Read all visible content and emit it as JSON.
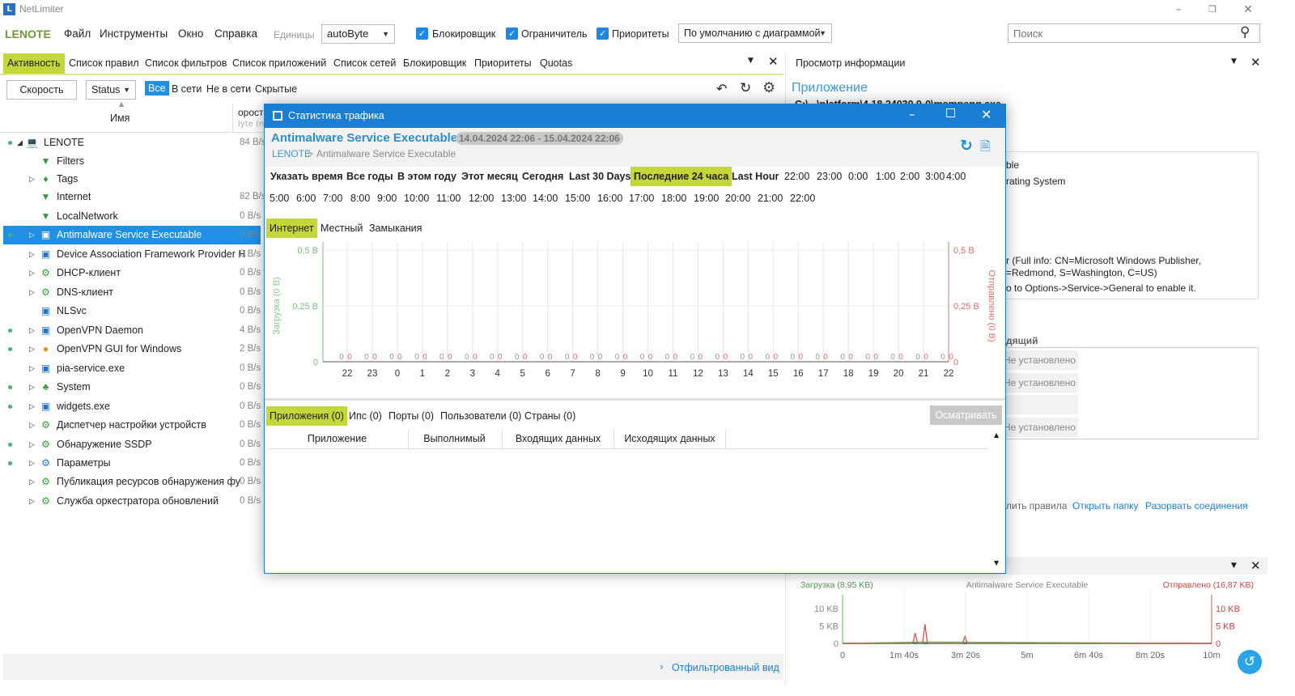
{
  "app": {
    "title": "NetLimiter",
    "logo": "netlimiter-logo",
    "computer": "LENOTE"
  },
  "menu": [
    "Файл",
    "Инструменты",
    "Окно",
    "Справка"
  ],
  "units": {
    "label": "Единицы",
    "value": "autoByte"
  },
  "checks": [
    {
      "label": "Блокировщик",
      "checked": true
    },
    {
      "label": "Ограничитель",
      "checked": true
    },
    {
      "label": "Приоритеты",
      "checked": true
    }
  ],
  "view_select": "По умолчанию с диаграммой",
  "search": {
    "placeholder": "Поиск"
  },
  "tabs": [
    "Активность",
    "Список правил",
    "Список фильтров",
    "Список приложений",
    "Список сетей",
    "Блокировщик",
    "Приоритеты",
    "Quotas"
  ],
  "toolbar": {
    "speed": "Скорость",
    "status": "Status",
    "filters": [
      "Все",
      "В сети",
      "Не в сети",
      "Скрытые"
    ]
  },
  "columns": {
    "name": "Имя",
    "speed": "орост",
    "speed_sub": "lyte (n"
  },
  "tree": [
    {
      "name": "LENOTE",
      "speed": "84 B/s",
      "dot": true,
      "level": 0,
      "exp": "open",
      "icon": "computer-icon"
    },
    {
      "name": "Filters",
      "speed": "",
      "dot": false,
      "level": 1,
      "exp": "",
      "icon": "filter-icon"
    },
    {
      "name": "Tags",
      "speed": "",
      "dot": false,
      "level": 1,
      "exp": "closed",
      "icon": "tag-icon"
    },
    {
      "name": "Internet",
      "speed": "82 B/s",
      "dot": false,
      "level": 1,
      "exp": "",
      "icon": "filter-icon"
    },
    {
      "name": "LocalNetwork",
      "speed": "0 B/s",
      "dot": false,
      "level": 1,
      "exp": "",
      "icon": "filter-icon"
    },
    {
      "name": "Antimalware Service Executable",
      "speed": "0 B/s",
      "dot": true,
      "level": 1,
      "exp": "closed",
      "icon": "app-window-icon",
      "selected": true
    },
    {
      "name": "Device Association Framework Provider H",
      "speed": "0 B/s",
      "dot": false,
      "level": 1,
      "exp": "closed",
      "icon": "app-window-icon"
    },
    {
      "name": "DHCP-клиент",
      "speed": "0 B/s",
      "dot": false,
      "level": 1,
      "exp": "closed",
      "icon": "service-gear-icon"
    },
    {
      "name": "DNS-клиент",
      "speed": "0 B/s",
      "dot": false,
      "level": 1,
      "exp": "closed",
      "icon": "service-gear-icon"
    },
    {
      "name": "NLSvc",
      "speed": "0 B/s",
      "dot": false,
      "level": 1,
      "exp": "",
      "icon": "app-window-icon"
    },
    {
      "name": "OpenVPN Daemon",
      "speed": "4 B/s",
      "dot": true,
      "level": 1,
      "exp": "closed",
      "icon": "app-window-icon"
    },
    {
      "name": "OpenVPN GUI for Windows",
      "speed": "2 B/s",
      "dot": true,
      "level": 1,
      "exp": "closed",
      "icon": "openvpn-icon"
    },
    {
      "name": "pia-service.exe",
      "speed": "0 B/s",
      "dot": false,
      "level": 1,
      "exp": "closed",
      "icon": "app-window-icon"
    },
    {
      "name": "System",
      "speed": "0 B/s",
      "dot": true,
      "level": 1,
      "exp": "closed",
      "icon": "system-icon"
    },
    {
      "name": "widgets.exe",
      "speed": "0 B/s",
      "dot": true,
      "level": 1,
      "exp": "closed",
      "icon": "app-window-icon"
    },
    {
      "name": "Диспетчер настройки устройств",
      "speed": "0 B/s",
      "dot": false,
      "level": 1,
      "exp": "closed",
      "icon": "service-gear-icon"
    },
    {
      "name": "Обнаружение SSDP",
      "speed": "0 B/s",
      "dot": true,
      "level": 1,
      "exp": "closed",
      "icon": "service-gear-icon"
    },
    {
      "name": "Параметры",
      "speed": "0 B/s",
      "dot": true,
      "level": 1,
      "exp": "closed",
      "icon": "settings-app-icon"
    },
    {
      "name": "Публикация ресурсов обнаружения фу",
      "speed": "0 B/s",
      "dot": false,
      "level": 1,
      "exp": "closed",
      "icon": "service-gear-icon"
    },
    {
      "name": "Служба оркестратора обновлений",
      "speed": "0 B/s",
      "dot": false,
      "level": 1,
      "exp": "closed",
      "icon": "service-gear-icon"
    }
  ],
  "status_bar": {
    "filtered_view": "Отфильтрованный вид"
  },
  "info": {
    "title": "Просмотр информации",
    "section": "Приложение",
    "path": "C:\\...\\platform\\4.18.24030.9-0\\msmpeng.exe",
    "lines": [
      "ble",
      "rating System",
      "r (Full info: CN=Microsoft Windows Publisher,",
      "=Redmond, S=Washington, C=US)",
      "o to Options->Service->General to enable it."
    ],
    "section2": "дящий",
    "values": [
      "Не установлено",
      "Не установлено",
      "",
      "Не установлено"
    ],
    "links": [
      "лить правила",
      "Открыть папку",
      "Разорвать соединения"
    ]
  },
  "dialog": {
    "title": "Статистика трафика",
    "app": "Antimalware Service Executable",
    "range": "14.04.2024 22:06 - 15.04.2024 22:06",
    "breadcrumb": [
      "LENOTE",
      ">",
      "Antimalware Service Executable"
    ],
    "periods": [
      "Указать время",
      "Все годы",
      "В этом году",
      "Этот месяц",
      "Сегодня",
      "Last 30 Days",
      "Последние 24 часа",
      "Last Hour"
    ],
    "active_period": "Последние 24 часа",
    "hours_row1": [
      "22:00",
      "23:00",
      "0:00",
      "1:00",
      "2:00",
      "3:00",
      "4:00"
    ],
    "hours_row2": [
      "5:00",
      "6:00",
      "7:00",
      "8:00",
      "9:00",
      "10:00",
      "11:00",
      "12:00",
      "13:00",
      "14:00",
      "15:00",
      "16:00",
      "17:00",
      "18:00",
      "19:00",
      "20:00",
      "21:00",
      "22:00"
    ],
    "net_tabs": [
      "Интернет",
      "Местный",
      "Замыкания"
    ],
    "bottom_tabs": [
      "Приложения (0)",
      "Ипс (0)",
      "Порты (0)",
      "Пользователи (0)",
      "Страны (0)"
    ],
    "inspect": "Осматривать",
    "table_headers": [
      "Приложение",
      "Выполнимый",
      "Входящих данных",
      "Исходящих данных"
    ]
  },
  "mini_panel": {
    "title": "Antimalware Service Executable"
  },
  "chart_data": [
    {
      "type": "bar",
      "title": "",
      "categories": [
        "22",
        "23",
        "0",
        "1",
        "2",
        "3",
        "4",
        "5",
        "6",
        "7",
        "8",
        "9",
        "10",
        "11",
        "12",
        "13",
        "14",
        "15",
        "16",
        "17",
        "18",
        "19",
        "20",
        "21",
        "22"
      ],
      "series": [
        {
          "name": "Загрузка (0 B)",
          "color": "#5cb85c",
          "values": [
            0,
            0,
            0,
            0,
            0,
            0,
            0,
            0,
            0,
            0,
            0,
            0,
            0,
            0,
            0,
            0,
            0,
            0,
            0,
            0,
            0,
            0,
            0,
            0,
            0
          ]
        },
        {
          "name": "Отправлено (0 B)",
          "color": "#d9534f",
          "values": [
            0,
            0,
            0,
            0,
            0,
            0,
            0,
            0,
            0,
            0,
            0,
            0,
            0,
            0,
            0,
            0,
            0,
            0,
            0,
            0,
            0,
            0,
            0,
            0,
            0
          ]
        }
      ],
      "ylabel": "Загрузка (0 B)",
      "y2label": "Отправлено (0 B)",
      "yticks": [
        "0",
        "0,25 B",
        "0,5 B"
      ],
      "y2ticks": [
        "0",
        "0,25 B",
        "0,5 B"
      ],
      "ylim": [
        0,
        0.5
      ],
      "grid": true
    },
    {
      "type": "line",
      "title": "Antimalware Service Executable",
      "xticks": [
        "0",
        "1m 40s",
        "3m 20s",
        "5m",
        "6m 40s",
        "8m 20s",
        "10m"
      ],
      "xlim": [
        0,
        600
      ],
      "yticks": [
        "0",
        "5 KB",
        "10 KB"
      ],
      "y2ticks": [
        "0",
        "5 KB",
        "10 KB"
      ],
      "ylim": [
        0,
        12
      ],
      "series": [
        {
          "name": "Загрузка (8,95 KB)",
          "color": "#5cb85c",
          "points": [
            [
              0,
              0
            ],
            [
              134,
              0.4
            ],
            [
              600,
              0
            ]
          ]
        },
        {
          "name": "Отправлено (16,87 KB)",
          "color": "#d9534f",
          "points": [
            [
              0,
              0
            ],
            [
              114,
              0
            ],
            [
              118,
              3
            ],
            [
              122,
              0
            ],
            [
              130,
              0
            ],
            [
              134,
              5.5
            ],
            [
              138,
              0
            ],
            [
              195,
              0
            ],
            [
              199,
              2
            ],
            [
              203,
              0
            ],
            [
              600,
              0
            ]
          ]
        }
      ]
    }
  ]
}
